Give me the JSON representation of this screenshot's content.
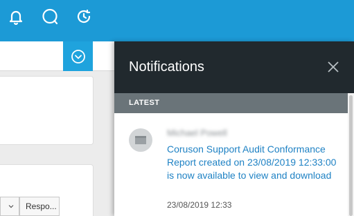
{
  "topbar": {
    "icons": [
      "bell-icon",
      "chat-bubble-icon",
      "history-clock-icon"
    ],
    "color": "#1c9ad6"
  },
  "background": {
    "table_headers": [
      "",
      "Respo..."
    ]
  },
  "notifications": {
    "title": "Notifications",
    "section_label": "LATEST",
    "items": [
      {
        "sender": "Michael Powell",
        "message": "Coruson Support Audit Conformance Report created on 23/08/2019 12:33:00 is now available to view and download",
        "timestamp": "23/08/2019 12:33"
      }
    ]
  },
  "colors": {
    "panel_header": "#21292e",
    "section_bar": "#6a7479",
    "link": "#1f82c4"
  }
}
